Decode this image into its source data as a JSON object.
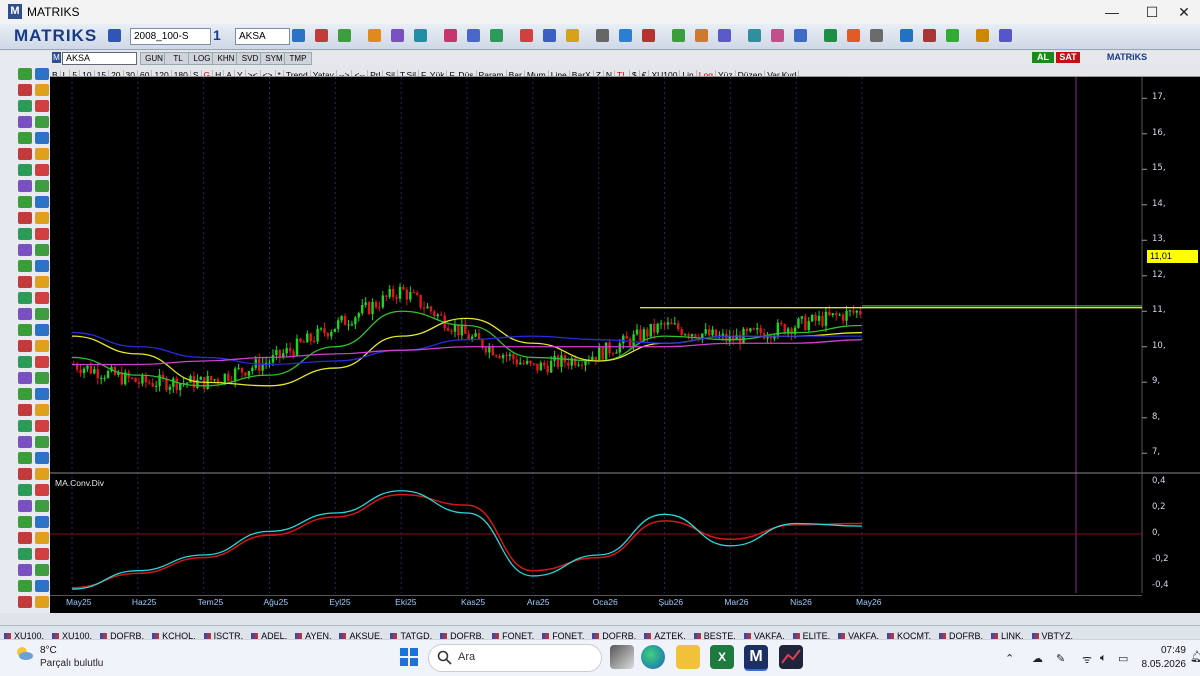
{
  "window": {
    "title": "MATRIKS",
    "logo_letter": "M",
    "minimize": "—",
    "maximize": "☐",
    "close": "✕"
  },
  "toolbar": {
    "brand": "MATRIKS",
    "layout_value": "2008_100-S",
    "window_count": "1",
    "symbol_value": "AKSA"
  },
  "chart_header": {
    "symbol": "AKSA",
    "tabs": [
      "GUN",
      "TL",
      "LOG",
      "KHN",
      "SVD",
      "SYM",
      "TMP"
    ],
    "al_label": "AL",
    "sat_label": "SAT",
    "mini_brand": "MATRiKS"
  },
  "chart_toolbar": [
    "B",
    "L",
    "5",
    "10",
    "15",
    "20",
    "30",
    "60",
    "120",
    "180",
    "S",
    "G",
    "H",
    "A",
    "Y",
    "><",
    "<>",
    "*",
    "Trend",
    "Yatay",
    "-->",
    "<--",
    "Prl",
    "Sil",
    "T.Sil",
    "F. Yük",
    "F. Düş",
    "Param",
    "Bar",
    "Mum",
    "Line",
    "BarX",
    "Z",
    "N",
    "TL",
    "$",
    "€",
    "XU100",
    "Lin",
    "Log",
    "Yüz",
    "Düzen",
    "Var.Kyd"
  ],
  "chart_toolbar_red": [
    "G",
    "TL",
    "Log"
  ],
  "price_axis": {
    "ticks": [
      "17,",
      "16,",
      "15,",
      "14,",
      "13,",
      "12,",
      "11,",
      "10,",
      "9,",
      "8,",
      "7,"
    ],
    "current": "11,01"
  },
  "macd_panel": {
    "title": "MA.Conv.Div",
    "ticks": [
      "0,4",
      "0,2",
      "0,",
      "-0,2",
      "-0,4"
    ]
  },
  "date_axis": [
    "May25",
    "Haz25",
    "Tem25",
    "Ağu25",
    "Eyl25",
    "Eki25",
    "Kas25",
    "Ara25",
    "Oca26",
    "Şub26",
    "Mar26",
    "Nis26",
    "May26"
  ],
  "symbol_tabs": [
    "XU100,",
    "XU100,",
    "DOFRB,",
    "KCHOL,",
    "ISCTR,",
    "ADEL,",
    "AYEN,",
    "AKSUE,",
    "TATGD,",
    "DOFRB,",
    "FONET,",
    "FONET,",
    "DOFRB,",
    "AZTEK,",
    "BESTE,",
    "VAKFA,",
    "ELITE,",
    "VAKFA,",
    "KOCMT,",
    "DOFRB,",
    "LINK,",
    "VBTYZ,"
  ],
  "taskbar": {
    "temperature": "8°C",
    "weather": "Parçalı bulutlu",
    "search_placeholder": "Ara",
    "time": "07:49",
    "date": "8.05.2026"
  },
  "chart_data": {
    "type": "line",
    "price_ylim": [
      6.5,
      17.6
    ],
    "macd_ylim": [
      -0.45,
      0.45
    ],
    "resistance_level": 11.1,
    "current_price": 11.01,
    "x": [
      "May25",
      "Haz25",
      "Tem25",
      "Ağu25",
      "Eyl25",
      "Eki25",
      "Kas25",
      "Ara25",
      "Oca26",
      "Şub26",
      "Mar26",
      "Nis26",
      "May26"
    ],
    "series": [
      {
        "values": [
          9.5,
          9.0,
          9.0,
          9.6,
          10.6,
          11.6,
          10.3,
          9.4,
          9.8,
          10.6,
          10.2,
          10.6,
          11.0
        ]
      },
      {
        "values": [
          9.7,
          9.2,
          8.9,
          9.2,
          10.0,
          11.0,
          10.6,
          9.7,
          9.6,
          10.3,
          10.2,
          10.4,
          10.6
        ]
      },
      {
        "values": [
          10.3,
          9.8,
          9.0,
          8.9,
          9.4,
          10.3,
          10.8,
          10.1,
          9.6,
          10.1,
          10.3,
          10.3,
          10.4
        ]
      },
      {
        "values": [
          10.4,
          10.0,
          9.7,
          9.5,
          9.6,
          9.9,
          10.2,
          10.3,
          10.2,
          10.1,
          10.3,
          10.3,
          10.3
        ]
      },
      {
        "values": [
          9.5,
          9.5,
          9.6,
          9.7,
          9.8,
          9.9,
          10.0,
          10.0,
          10.0,
          10.0,
          10.1,
          10.1,
          10.2
        ]
      }
    ],
    "macd": {
      "line": [
        -0.42,
        -0.28,
        -0.16,
        0.02,
        0.16,
        0.33,
        0.16,
        -0.32,
        -0.16,
        0.15,
        -0.09,
        0.08,
        0.06
      ],
      "signal": [
        -0.41,
        -0.3,
        -0.18,
        -0.01,
        0.13,
        0.3,
        0.22,
        -0.28,
        -0.18,
        0.1,
        -0.04,
        0.07,
        0.08
      ]
    }
  }
}
